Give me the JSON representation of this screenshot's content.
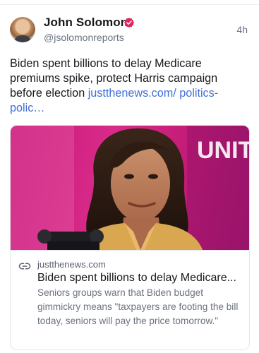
{
  "post": {
    "author": {
      "name": "John Solomon",
      "handle": "@jsolomonreports",
      "verified": true
    },
    "timestamp": "4h",
    "text": "Biden spent billions to delay Medicare premiums spike, protect Harris campaign before election",
    "text_link": "justthenews.com/ politics-polic…",
    "card": {
      "image_sign_text": "UNIT",
      "domain": "justthenews.com",
      "title": "Biden spent billions to delay Medicare...",
      "description": "Seniors groups warn that Biden budget gimmickry means \"taxpayers are footing the bill today, seniors will pay the price tomorrow.\""
    }
  },
  "colors": {
    "link": "#3f6fd8",
    "verified_badge": "#e0245e",
    "card_image_bg": "#c5127a"
  },
  "icons": {
    "verified": "verified-badge-icon",
    "link": "link-chain-icon"
  }
}
